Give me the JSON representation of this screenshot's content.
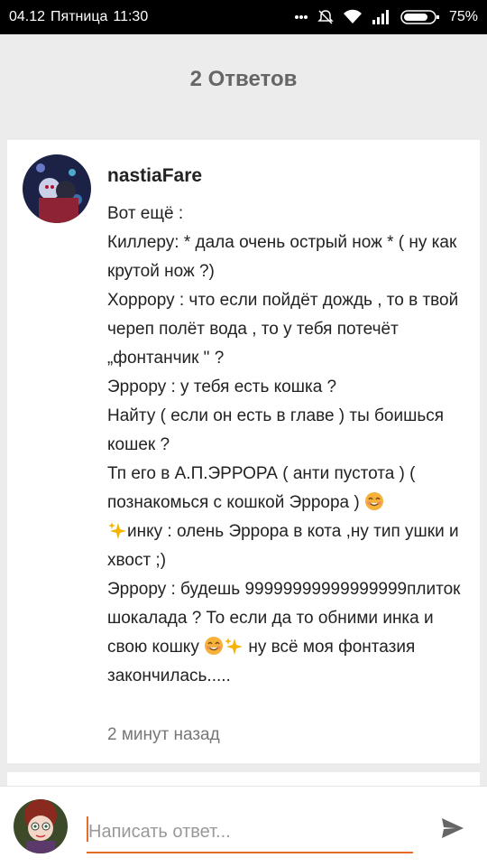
{
  "status_bar": {
    "date": "04.12",
    "day": "Пятница",
    "time": "11:30",
    "battery": "75%"
  },
  "header": {
    "title": "2 Ответов"
  },
  "comment": {
    "username": "nastiaFare",
    "lines": [
      "Вот ещё :",
      "Киллеру: * дала очень острый нож * ( ну как крутой нож ?)",
      "Хоррору : что если пойдёт дождь , то в твой череп полёт вода , то у тебя потечёт „фонтанчик \" ?",
      "Эррору : у тебя есть кошка ?",
      "Найту ( если он есть в главе ) ты боишься кошек ?",
      "Тп его в А.П.ЭРРОРА ( анти пустота ) ( познакомься с кошкой Эррора )",
      "инку : олень Эррора в кота ,ну тип ушки и хвост ;)",
      "Эррору : будешь 99999999999999999плиток шокалада ? То если да то обними инка и свою кошку",
      "ну всё моя фонтазия закончилась....."
    ],
    "timestamp": "2 минут назад"
  },
  "reply": {
    "placeholder": "Написать ответ..."
  },
  "icons": {
    "wifi": "wifi-icon",
    "signal": "signal-icon",
    "mute": "mute-icon",
    "battery": "battery-icon",
    "send": "send-icon",
    "emoji_smile": "smiling-face-icon",
    "emoji_sparkles": "sparkles-icon"
  },
  "colors": {
    "accent": "#e86a2c",
    "background": "#ececec"
  }
}
